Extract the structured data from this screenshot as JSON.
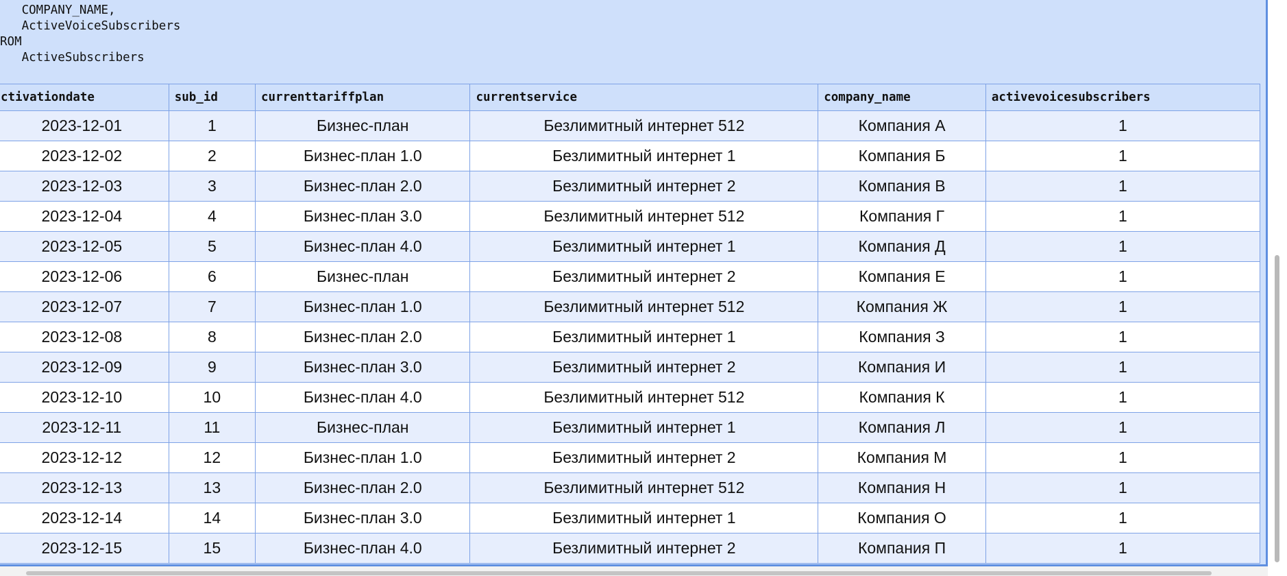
{
  "sql": {
    "lines": [
      "   COMPANY_NAME,",
      "   ActiveVoiceSubscribers",
      "ROM",
      "   ActiveSubscribers"
    ]
  },
  "table": {
    "columns": [
      "ctivationdate",
      "sub_id",
      "currenttariffplan",
      "currentservice",
      "company_name",
      "activevoicesubscribers"
    ],
    "rows": [
      [
        "2023-12-01",
        "1",
        "Бизнес-план",
        "Безлимитный интернет 512",
        "Компания А",
        "1"
      ],
      [
        "2023-12-02",
        "2",
        "Бизнес-план 1.0",
        "Безлимитный интернет 1",
        "Компания Б",
        "1"
      ],
      [
        "2023-12-03",
        "3",
        "Бизнес-план 2.0",
        "Безлимитный интернет 2",
        "Компания В",
        "1"
      ],
      [
        "2023-12-04",
        "4",
        "Бизнес-план 3.0",
        "Безлимитный интернет 512",
        "Компания Г",
        "1"
      ],
      [
        "2023-12-05",
        "5",
        "Бизнес-план 4.0",
        "Безлимитный интернет 1",
        "Компания Д",
        "1"
      ],
      [
        "2023-12-06",
        "6",
        "Бизнес-план",
        "Безлимитный интернет 2",
        "Компания Е",
        "1"
      ],
      [
        "2023-12-07",
        "7",
        "Бизнес-план 1.0",
        "Безлимитный интернет 512",
        "Компания Ж",
        "1"
      ],
      [
        "2023-12-08",
        "8",
        "Бизнес-план 2.0",
        "Безлимитный интернет 1",
        "Компания З",
        "1"
      ],
      [
        "2023-12-09",
        "9",
        "Бизнес-план 3.0",
        "Безлимитный интернет 2",
        "Компания И",
        "1"
      ],
      [
        "2023-12-10",
        "10",
        "Бизнес-план 4.0",
        "Безлимитный интернет 512",
        "Компания К",
        "1"
      ],
      [
        "2023-12-11",
        "11",
        "Бизнес-план",
        "Безлимитный интернет 1",
        "Компания Л",
        "1"
      ],
      [
        "2023-12-12",
        "12",
        "Бизнес-план 1.0",
        "Безлимитный интернет 2",
        "Компания М",
        "1"
      ],
      [
        "2023-12-13",
        "13",
        "Бизнес-план 2.0",
        "Безлимитный интернет 512",
        "Компания Н",
        "1"
      ],
      [
        "2023-12-14",
        "14",
        "Бизнес-план 3.0",
        "Безлимитный интернет 1",
        "Компания О",
        "1"
      ],
      [
        "2023-12-15",
        "15",
        "Бизнес-план 4.0",
        "Безлимитный интернет 2",
        "Компания П",
        "1"
      ]
    ]
  },
  "colors": {
    "header_bg": "#cfe0fb",
    "row_odd": "#e7eefd",
    "row_even": "#ffffff",
    "border": "#7ea2e6",
    "frame": "#5f8fe0"
  }
}
